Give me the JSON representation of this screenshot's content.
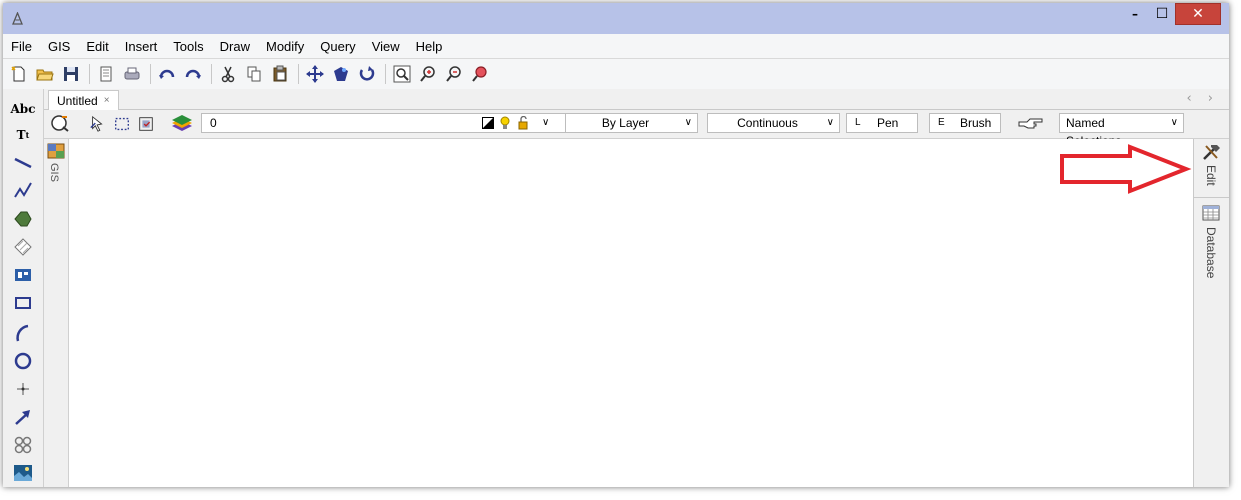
{
  "window": {
    "title": "",
    "minimize_glyph": "–",
    "maximize_glyph": "☐",
    "close_glyph": "✕"
  },
  "menu": {
    "items": [
      "File",
      "GIS",
      "Edit",
      "Insert",
      "Tools",
      "Draw",
      "Modify",
      "Query",
      "View",
      "Help"
    ]
  },
  "toolbar": {
    "icons": [
      "new-document-icon",
      "open-folder-icon",
      "save-icon",
      "print-preview-icon",
      "print-icon",
      "undo-icon",
      "redo-icon",
      "cut-icon",
      "copy-icon",
      "paste-icon",
      "pan-icon",
      "zoom-all-icon",
      "refresh-icon",
      "zoom-window-icon",
      "zoom-in-icon",
      "zoom-out-icon",
      "zoom-previous-icon"
    ]
  },
  "left_tools": {
    "text_tool": "Abc",
    "text_style_tool": "T",
    "icons": [
      "line-icon",
      "polyline-icon",
      "polygon-icon",
      "hatch-icon",
      "block-icon",
      "rectangle-icon",
      "arc-icon",
      "circle-icon",
      "point-icon",
      "arrow-icon",
      "multi-point-icon",
      "image-icon"
    ]
  },
  "document_tab": {
    "label": "Untitled",
    "close_glyph": "×",
    "nav_arrows": "‹ ›"
  },
  "layer_bar": {
    "current_layer": "0",
    "color": "By Layer",
    "linetype": "Continuous",
    "pen_key": "L",
    "pen_label": "Pen",
    "brush_key": "E",
    "brush_label": "Brush",
    "named_selections": "Named Selections"
  },
  "left_panel": {
    "tab_label": "GIS"
  },
  "right_panel": {
    "edit_tab": "Edit",
    "database_tab": "Database"
  },
  "colors": {
    "titlebar": "#b7c2e8",
    "close_button": "#c7443b",
    "annotation_arrow": "#e3262d"
  }
}
